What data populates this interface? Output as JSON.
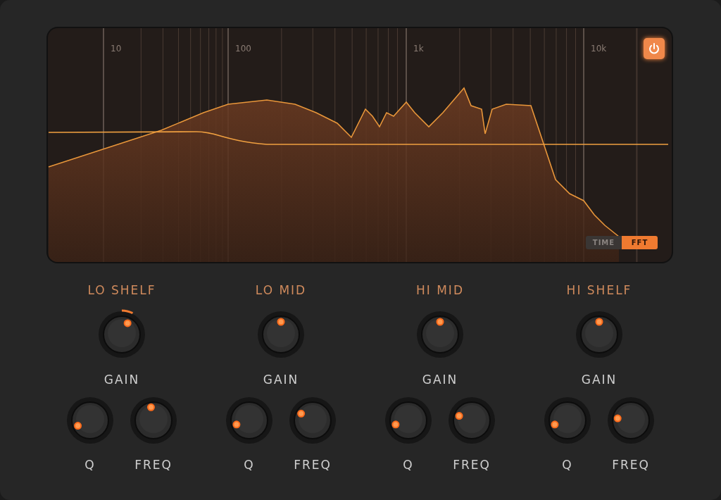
{
  "analyzer": {
    "scale_labels": [
      "10",
      "100",
      "1k",
      "10k"
    ],
    "power": {
      "on": true
    },
    "modes": [
      {
        "label": "TIME",
        "selected": false
      },
      {
        "label": "FFT",
        "selected": true
      }
    ]
  },
  "bands": [
    {
      "name": "LO SHELF",
      "gain": {
        "label": "GAIN",
        "level": 0.6
      },
      "q": {
        "label": "Q",
        "level": 0.08
      },
      "freq": {
        "label": "FREQ",
        "level": 0.46
      }
    },
    {
      "name": "LO MID",
      "gain": {
        "label": "GAIN",
        "level": 0.5
      },
      "q": {
        "label": "Q",
        "level": 0.1
      },
      "freq": {
        "label": "FREQ",
        "level": 0.28
      }
    },
    {
      "name": "HI MID",
      "gain": {
        "label": "GAIN",
        "level": 0.5
      },
      "q": {
        "label": "Q",
        "level": 0.1
      },
      "freq": {
        "label": "FREQ",
        "level": 0.24
      }
    },
    {
      "name": "HI SHELF",
      "gain": {
        "label": "GAIN",
        "level": 0.5
      },
      "q": {
        "label": "Q",
        "level": 0.1
      },
      "freq": {
        "label": "FREQ",
        "level": 0.2
      }
    }
  ]
}
